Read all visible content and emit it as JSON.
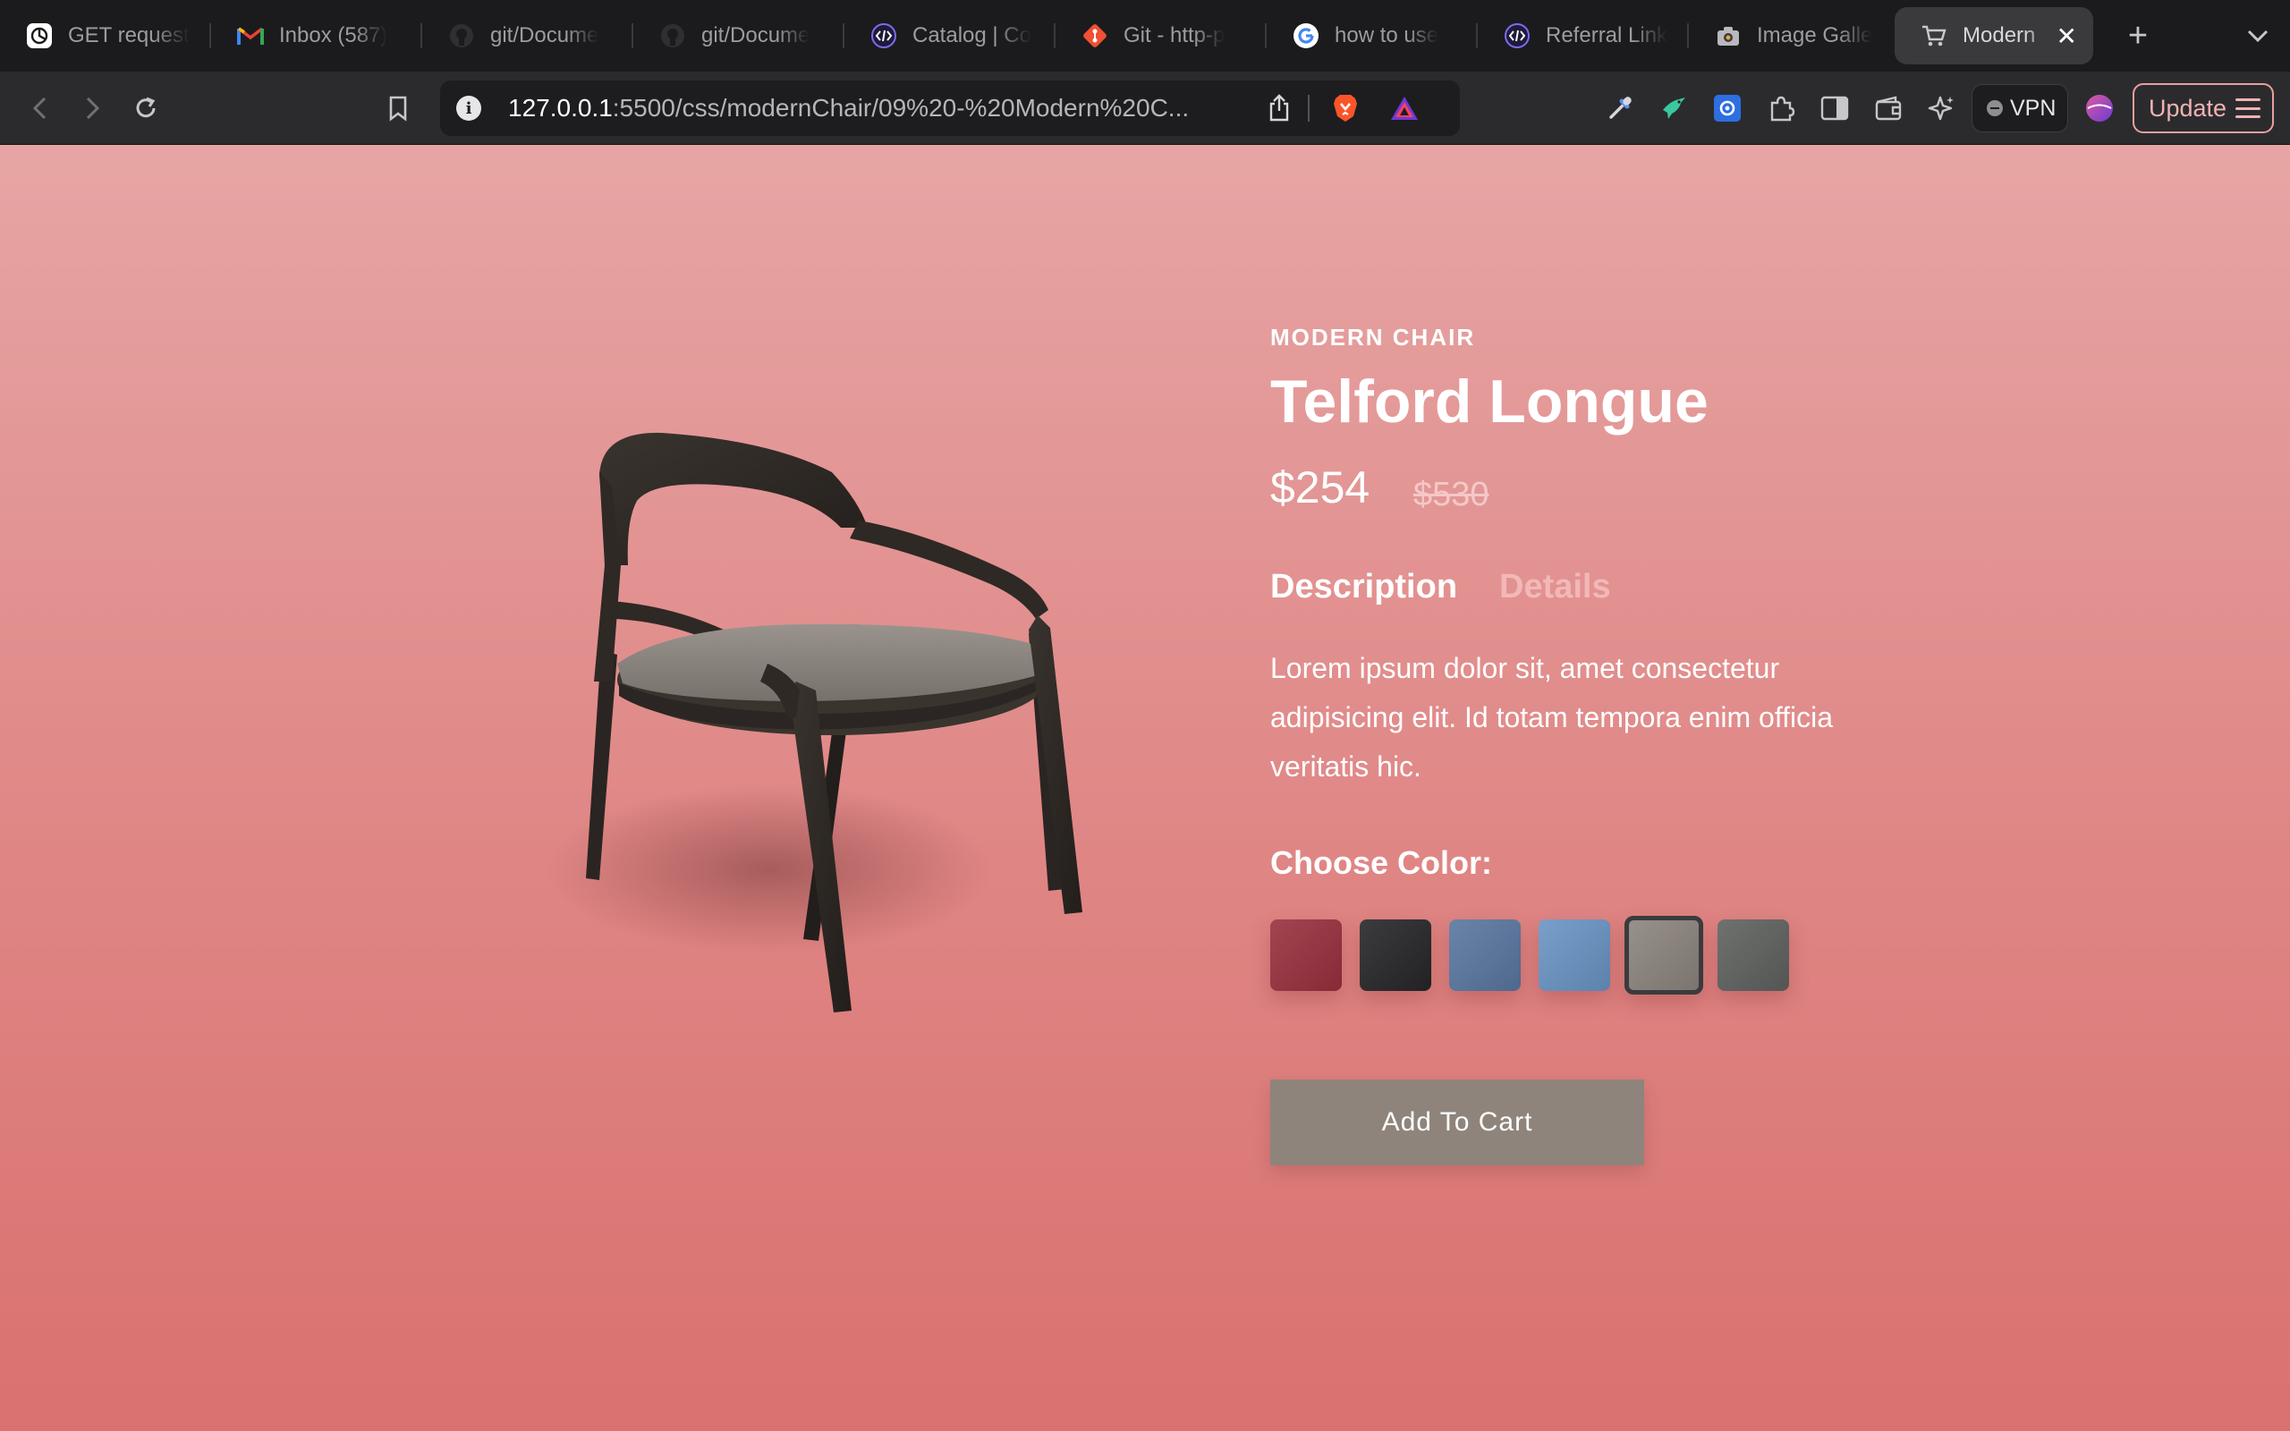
{
  "browser": {
    "tabs": [
      {
        "label": "GET request",
        "icon": "chatgpt-icon",
        "active": false
      },
      {
        "label": "Inbox (587)",
        "icon": "gmail-icon",
        "active": false
      },
      {
        "label": "git/Docume",
        "icon": "github-icon",
        "active": false
      },
      {
        "label": "git/Docume",
        "icon": "github-icon",
        "active": false
      },
      {
        "label": "Catalog | Co",
        "icon": "code-icon",
        "active": false
      },
      {
        "label": "Git - http-p",
        "icon": "git-icon",
        "active": false
      },
      {
        "label": "how to use",
        "icon": "google-icon",
        "active": false
      },
      {
        "label": "Referral Link",
        "icon": "code-icon",
        "active": false
      },
      {
        "label": "Image Galle",
        "icon": "camera-icon",
        "active": false
      },
      {
        "label": "Modern",
        "icon": "cart-icon",
        "active": true
      }
    ],
    "new_tab": "+",
    "close_tab": "✕",
    "url": {
      "host": "127.0.0.1",
      "rest": ":5500/css/modernChair/09%20-%20Modern%20C..."
    },
    "vpn_label": "VPN",
    "update_label": "Update"
  },
  "product": {
    "eyebrow": "MODERN CHAIR",
    "title": "Telford Longue",
    "price": "$254",
    "old_price": "$530",
    "tabs": {
      "description": "Description",
      "details": "Details"
    },
    "description": "Lorem ipsum dolor sit, amet consectetur adipisicing elit. Id totam tempora enim officia veritatis hic.",
    "choose_color_label": "Choose Color:",
    "colors": [
      {
        "name": "burgundy",
        "hex": "#9a2f3e",
        "selected": false
      },
      {
        "name": "black",
        "hex": "#262628",
        "selected": false
      },
      {
        "name": "denim",
        "hex": "#5a76a0",
        "selected": false
      },
      {
        "name": "light-blue",
        "hex": "#6a94c4",
        "selected": false
      },
      {
        "name": "taupe",
        "hex": "#8c847e",
        "selected": true
      },
      {
        "name": "grey",
        "hex": "#5f615f",
        "selected": false
      }
    ],
    "cart_label": "Add To Cart"
  },
  "colors": {
    "page_top": "#e6a5a4",
    "page_bottom": "#d9716f",
    "button_bg": "#8e847c",
    "chair_frame": "#2e2925",
    "chair_seat": "#8d8680"
  }
}
